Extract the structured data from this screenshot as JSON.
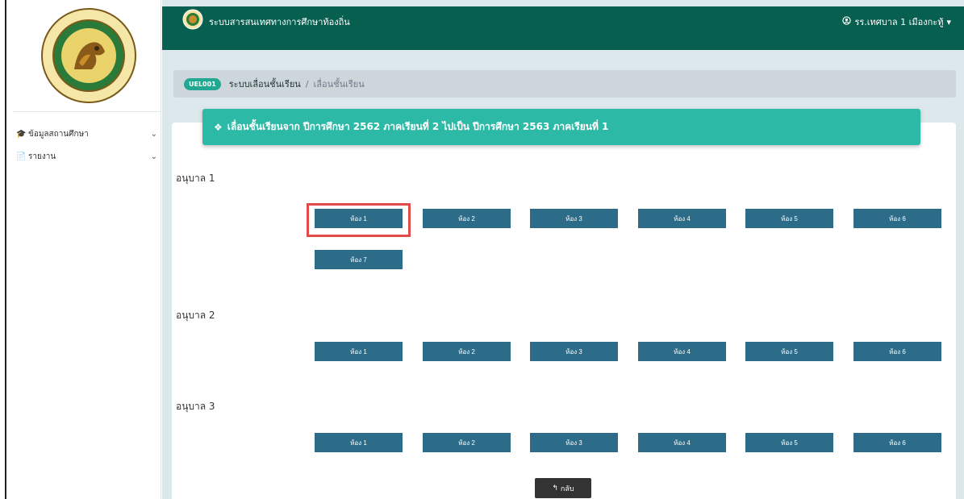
{
  "app": {
    "title": "ระบบสารสนเทศทางการศึกษาท้องถิ่น",
    "user": "รร.เทศบาล 1 เมืองกะทู้",
    "user_icon": "user-circle-icon",
    "caret": "▾",
    "brand_color": "#075f4f"
  },
  "sidebar": {
    "items": [
      {
        "icon": "graduation-cap-icon",
        "glyph": "🎓",
        "label": "ข้อมูลสถานศึกษา",
        "chevron": "⌄"
      },
      {
        "icon": "document-icon",
        "glyph": "📄",
        "label": "รายงาน",
        "chevron": "⌄"
      }
    ]
  },
  "breadcrumb": {
    "badge": "UEL001",
    "module": "ระบบเลื่อนชั้นเรียน",
    "separator": "/",
    "current": "เลื่อนชั้นเรียน"
  },
  "banner": {
    "icon": "layers-icon",
    "glyph": "❖",
    "text": "เลื่อนชั้นเรียนจาก ปีการศึกษา 2562 ภาคเรียนที่ 2 ไปเป็น ปีการศึกษา 2563 ภาคเรียนที่ 1",
    "color": "#2cbaa6"
  },
  "levels": [
    {
      "title": "อนุบาล 1",
      "rooms": [
        "ห้อง 1",
        "ห้อง 2",
        "ห้อง 3",
        "ห้อง 4",
        "ห้อง 5",
        "ห้อง 6",
        "ห้อง 7"
      ]
    },
    {
      "title": "อนุบาล 2",
      "rooms": [
        "ห้อง 1",
        "ห้อง 2",
        "ห้อง 3",
        "ห้อง 4",
        "ห้อง 5",
        "ห้อง 6"
      ]
    },
    {
      "title": "อนุบาล 3",
      "rooms": [
        "ห้อง 1",
        "ห้อง 2",
        "ห้อง 3",
        "ห้อง 4",
        "ห้อง 5",
        "ห้อง 6"
      ]
    }
  ],
  "room_button_color": "#2c6c88",
  "highlight_color": "#e34b4b",
  "back_button": {
    "icon": "reply-icon",
    "glyph": "↰",
    "label": "กลับ"
  }
}
